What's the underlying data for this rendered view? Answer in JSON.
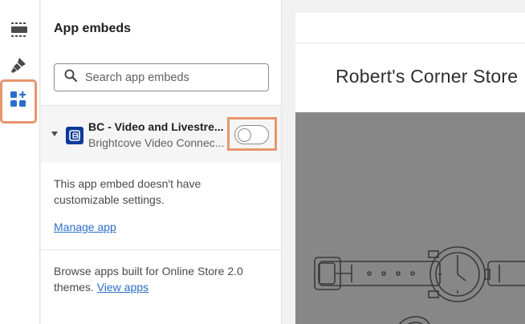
{
  "sidebar": {
    "icons": [
      {
        "name": "sections-icon",
        "active": false
      },
      {
        "name": "theme-settings-brush-icon",
        "active": false
      },
      {
        "name": "app-embeds-icon",
        "active": true
      }
    ]
  },
  "panel": {
    "title": "App embeds",
    "search_placeholder": "Search app embeds",
    "embed": {
      "name": "BC - Video and Livestre...",
      "subtitle": "Brightcove Video Connec...",
      "enabled": false
    },
    "no_settings_text": "This app embed doesn't have customizable settings.",
    "manage_link": "Manage app",
    "browse_text": "Browse apps built for Online Store 2.0 themes.",
    "view_apps_link": "View apps"
  },
  "preview": {
    "store_name": "Robert's Corner Store"
  },
  "colors": {
    "accent_highlight": "#e8956d",
    "link": "#2c6ecb",
    "active_icon": "#2c6ecb",
    "app_logo": "#0b3a9c",
    "hero_bg": "#878787"
  }
}
